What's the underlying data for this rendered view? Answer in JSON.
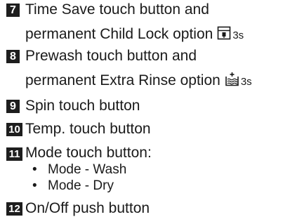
{
  "items": [
    {
      "number": "7",
      "line1": "Time Save touch button and",
      "line2": "permanent Child Lock option",
      "symbol_icon": "child-lock-icon",
      "duration": "3s"
    },
    {
      "number": "8",
      "line1": "Prewash touch button and",
      "line2": "permanent Extra Rinse option",
      "symbol_icon": "extra-rinse-icon",
      "duration": "3s"
    },
    {
      "number": "9",
      "line1": "Spin touch button"
    },
    {
      "number": "10",
      "line1": "Temp. touch button"
    },
    {
      "number": "11",
      "line1": "Mode touch button:",
      "bullets": [
        "Mode - Wash",
        "Mode - Dry"
      ]
    },
    {
      "number": "12",
      "line1": "On/Off push button"
    }
  ],
  "bullet_char": "•",
  "colors": {
    "badge_background": "#1e1e1e",
    "badge_text": "#ffffff",
    "text": "#1a1a1a"
  }
}
